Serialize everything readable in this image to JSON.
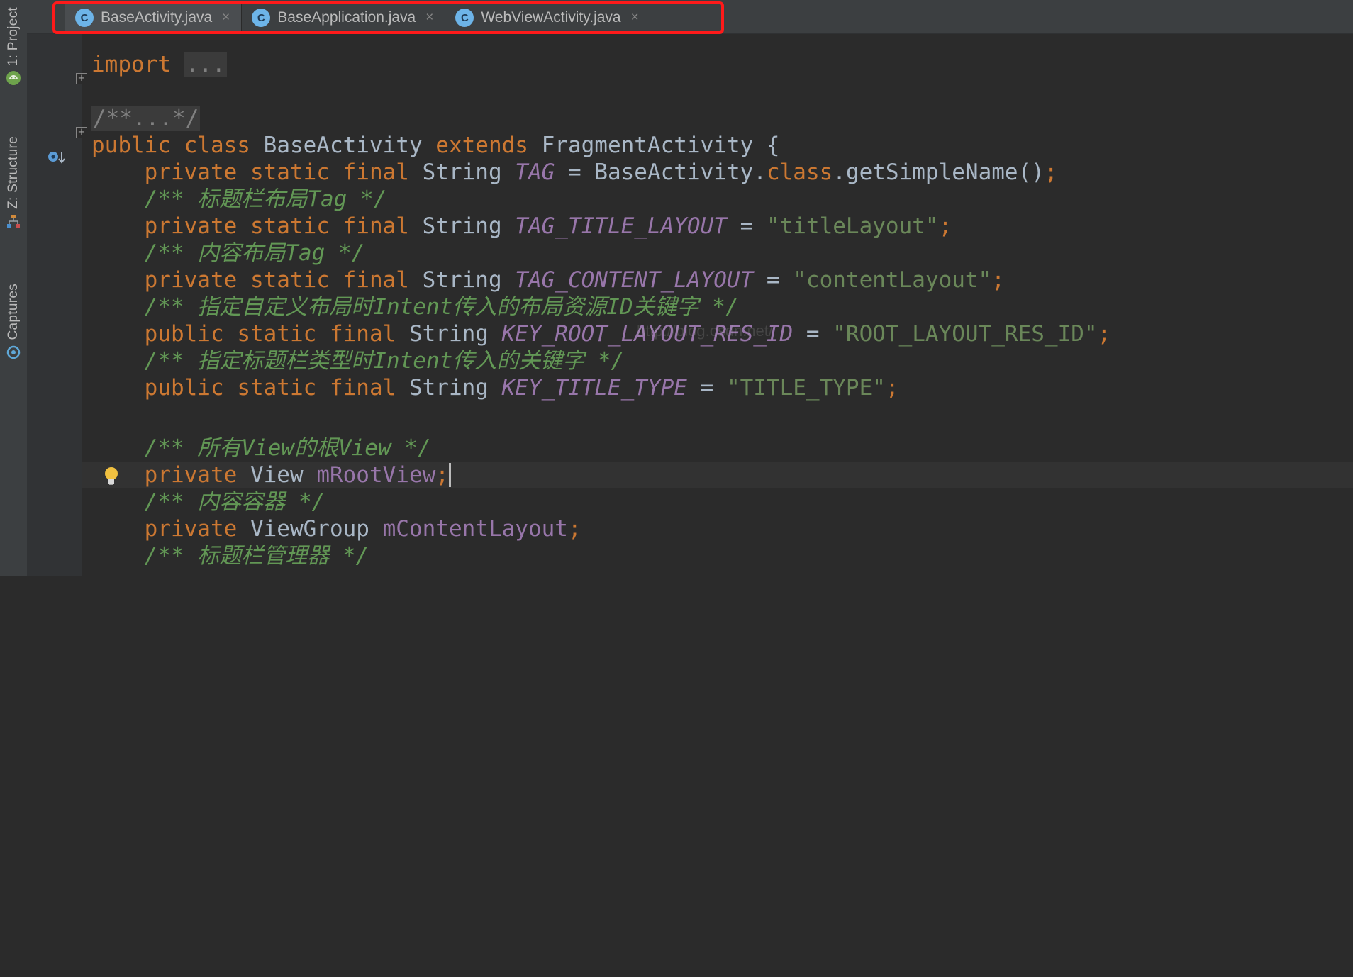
{
  "tool_windows": [
    {
      "label": "1: Project",
      "icon": "android-icon"
    },
    {
      "label": "Z: Structure",
      "icon": "structure-icon"
    },
    {
      "label": "Captures",
      "icon": "captures-icon"
    }
  ],
  "tabs": [
    {
      "icon_letter": "C",
      "label": "BaseActivity.java",
      "active": true
    },
    {
      "icon_letter": "C",
      "label": "BaseApplication.java",
      "active": false
    },
    {
      "icon_letter": "C",
      "label": "WebViewActivity.java",
      "active": false
    }
  ],
  "tab_close_glyph": "×",
  "highlight_color": "#ff1a1a",
  "watermark": "http://blog.csdn.net/",
  "code": {
    "import_kw": "import",
    "import_fold": "...",
    "doc_fold": "/**...*/",
    "l_class": {
      "k1": "public",
      "k2": "class",
      "name": "BaseActivity",
      "k3": "extends",
      "parent": "FragmentActivity",
      "brace": "{"
    },
    "l_tag": {
      "k1": "private",
      "k2": "static",
      "k3": "final",
      "type": "String",
      "name": "TAG",
      "eq": "=",
      "rhs1": "BaseActivity.",
      "rhs_kw": "class",
      "rhs2": ".getSimpleName()",
      "semi": ";"
    },
    "c1": "/** 标题栏布局Tag */",
    "l_title": {
      "k1": "private",
      "k2": "static",
      "k3": "final",
      "type": "String",
      "name": "TAG_TITLE_LAYOUT",
      "eq": "=",
      "value": "\"titleLayout\"",
      "semi": ";"
    },
    "c2": "/** 内容布局Tag */",
    "l_content": {
      "k1": "private",
      "k2": "static",
      "k3": "final",
      "type": "String",
      "name": "TAG_CONTENT_LAYOUT",
      "eq": "=",
      "value": "\"contentLayout\"",
      "semi": ";"
    },
    "c3": "/** 指定自定义布局时Intent传入的布局资源ID关键字 */",
    "l_root": {
      "k1": "public",
      "k2": "static",
      "k3": "final",
      "type": "String",
      "name": "KEY_ROOT_LAYOUT_RES_ID",
      "eq": "=",
      "value": "\"ROOT_LAYOUT_RES_ID\"",
      "semi": ";"
    },
    "c4": "/** 指定标题栏类型时Intent传入的关键字 */",
    "l_ttype": {
      "k1": "public",
      "k2": "static",
      "k3": "final",
      "type": "String",
      "name": "KEY_TITLE_TYPE",
      "eq": "=",
      "value": "\"TITLE_TYPE\"",
      "semi": ";"
    },
    "c5": "/** 所有View的根View */",
    "l_rootview": {
      "k1": "private",
      "type": "View",
      "name": "mRootView",
      "semi": ";"
    },
    "c6": "/** 内容容器 */",
    "l_contentlayout": {
      "k1": "private",
      "type": "ViewGroup",
      "name": "mContentLayout",
      "semi": ";"
    },
    "c7": "/** 标题栏管理器 */"
  }
}
